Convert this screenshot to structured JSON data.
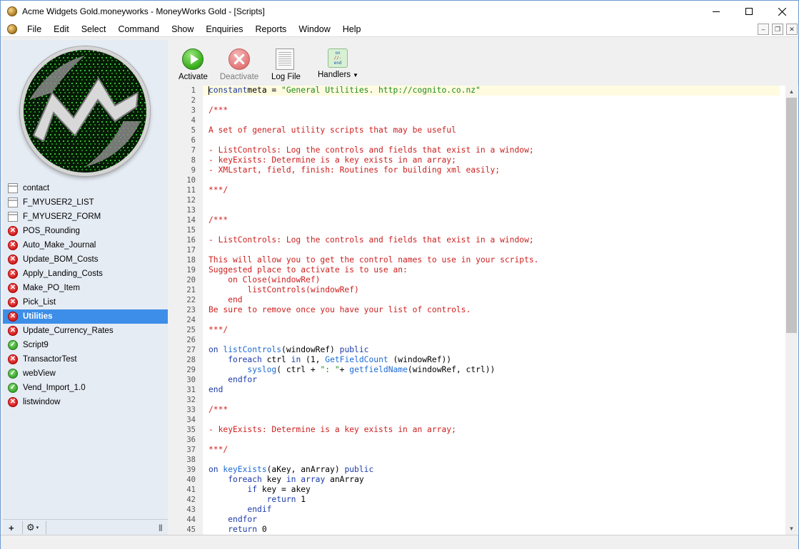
{
  "window": {
    "title": "Acme Widgets Gold.moneyworks - MoneyWorks Gold - [Scripts]"
  },
  "menu": {
    "items": [
      "File",
      "Edit",
      "Select",
      "Command",
      "Show",
      "Enquiries",
      "Reports",
      "Window",
      "Help"
    ]
  },
  "sidebar": {
    "scripts": [
      {
        "name": "contact",
        "status": "form"
      },
      {
        "name": "F_MYUSER2_LIST",
        "status": "form"
      },
      {
        "name": "F_MYUSER2_FORM",
        "status": "form"
      },
      {
        "name": "POS_Rounding",
        "status": "inactive"
      },
      {
        "name": "Auto_Make_Journal",
        "status": "inactive"
      },
      {
        "name": "Update_BOM_Costs",
        "status": "inactive"
      },
      {
        "name": "Apply_Landing_Costs",
        "status": "inactive"
      },
      {
        "name": "Make_PO_Item",
        "status": "inactive"
      },
      {
        "name": "Pick_List",
        "status": "inactive"
      },
      {
        "name": "Utilities",
        "status": "inactive",
        "selected": true
      },
      {
        "name": "Update_Currency_Rates",
        "status": "inactive"
      },
      {
        "name": "Script9",
        "status": "active"
      },
      {
        "name": "TransactorTest",
        "status": "inactive"
      },
      {
        "name": "webView",
        "status": "active"
      },
      {
        "name": "Vend_Import_1.0",
        "status": "active"
      },
      {
        "name": "listwindow",
        "status": "inactive"
      }
    ],
    "footer": {
      "add": "+",
      "gear": "⚙",
      "gear_caret": "▾",
      "grip": "|||"
    }
  },
  "toolbar": {
    "activate": "Activate",
    "deactivate": "Deactivate",
    "log_file": "Log File",
    "handlers": "Handlers",
    "handlers_icon": [
      "on",
      "//-",
      "end"
    ]
  },
  "editor": {
    "lines": [
      [
        [
          "k",
          "constant"
        ],
        [
          "",
          "meta = "
        ],
        [
          "s",
          "\"General Utilities. http://cognito.co.nz\""
        ]
      ],
      [],
      [
        [
          "c",
          "/***"
        ]
      ],
      [],
      [
        [
          "c",
          "A set of general utility scripts that may be useful"
        ]
      ],
      [],
      [
        [
          "c",
          "- ListControls: Log the controls and fields that exist in a window;"
        ]
      ],
      [
        [
          "c",
          "- keyExists: Determine is a key exists in an array;"
        ]
      ],
      [
        [
          "c",
          "- XMLstart, field, finish: Routines for building xml easily;"
        ]
      ],
      [],
      [
        [
          "c",
          "***/"
        ]
      ],
      [],
      [],
      [
        [
          "c",
          "/***"
        ]
      ],
      [],
      [
        [
          "c",
          "- ListControls: Log the controls and fields that exist in a window;"
        ]
      ],
      [],
      [
        [
          "c",
          "This will allow you to get the control names to use in your scripts."
        ]
      ],
      [
        [
          "c",
          "Suggested place to activate is to use an:"
        ]
      ],
      [
        [
          "c",
          "    on Close(windowRef)"
        ]
      ],
      [
        [
          "c",
          "        listControls(windowRef)"
        ]
      ],
      [
        [
          "c",
          "    end"
        ]
      ],
      [
        [
          "c",
          "Be sure to remove once you have your list of controls."
        ]
      ],
      [],
      [
        [
          "c",
          "***/"
        ]
      ],
      [],
      [
        [
          "k",
          "on "
        ],
        [
          "f",
          "listControls"
        ],
        [
          "",
          "(windowRef) "
        ],
        [
          "k",
          "public"
        ]
      ],
      [
        [
          "",
          "    "
        ],
        [
          "k",
          "foreach"
        ],
        [
          "",
          " ctrl "
        ],
        [
          "k",
          "in"
        ],
        [
          "",
          " (1, "
        ],
        [
          "f",
          "GetFieldCount"
        ],
        [
          "",
          " (windowRef))"
        ]
      ],
      [
        [
          "",
          "        "
        ],
        [
          "f",
          "syslog"
        ],
        [
          "",
          "( ctrl + "
        ],
        [
          "s",
          "\": \""
        ],
        [
          "",
          "+ "
        ],
        [
          "f",
          "getfieldName"
        ],
        [
          "",
          "(windowRef, ctrl))"
        ]
      ],
      [
        [
          "",
          "    "
        ],
        [
          "k",
          "endfor"
        ]
      ],
      [
        [
          "k",
          "end"
        ]
      ],
      [],
      [
        [
          "c",
          "/***"
        ]
      ],
      [],
      [
        [
          "c",
          "- keyExists: Determine is a key exists in an array;"
        ]
      ],
      [],
      [
        [
          "c",
          "***/"
        ]
      ],
      [],
      [
        [
          "k",
          "on "
        ],
        [
          "f",
          "keyExists"
        ],
        [
          "",
          "(aKey, anArray) "
        ],
        [
          "k",
          "public"
        ]
      ],
      [
        [
          "",
          "    "
        ],
        [
          "k",
          "foreach"
        ],
        [
          "",
          " key "
        ],
        [
          "k",
          "in array"
        ],
        [
          "",
          " anArray"
        ]
      ],
      [
        [
          "",
          "        "
        ],
        [
          "k",
          "if"
        ],
        [
          "",
          " key = akey"
        ]
      ],
      [
        [
          "",
          "            "
        ],
        [
          "k",
          "return"
        ],
        [
          "",
          " 1"
        ]
      ],
      [
        [
          "",
          "        "
        ],
        [
          "k",
          "endif"
        ]
      ],
      [
        [
          "",
          "    "
        ],
        [
          "k",
          "endfor"
        ]
      ],
      [
        [
          "",
          "    "
        ],
        [
          "k",
          "return"
        ],
        [
          "",
          " 0"
        ]
      ]
    ]
  }
}
